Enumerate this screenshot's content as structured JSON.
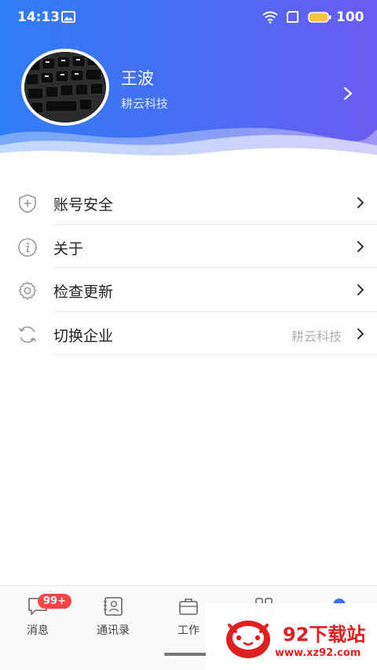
{
  "status_bar": {
    "time": "14:13",
    "battery": "100"
  },
  "profile": {
    "name": "王波",
    "company": "耕云科技"
  },
  "menu": [
    {
      "label": "账号安全",
      "value": "",
      "icon": "shield-icon"
    },
    {
      "label": "关于",
      "value": "",
      "icon": "info-icon"
    },
    {
      "label": "检查更新",
      "value": "",
      "icon": "gear-icon"
    },
    {
      "label": "切换企业",
      "value": "耕云科技",
      "icon": "refresh-icon"
    }
  ],
  "tabs": [
    {
      "label": "消息",
      "badge": "99+",
      "icon": "message-icon"
    },
    {
      "label": "通讯录",
      "icon": "contacts-icon"
    },
    {
      "label": "工作",
      "icon": "briefcase-icon"
    },
    {
      "label": "",
      "icon": "apps-icon"
    },
    {
      "label": "",
      "icon": "person-icon",
      "active": true
    }
  ],
  "watermark": {
    "title": "92下载站",
    "url": "www.xz92.com"
  },
  "colors": {
    "header_start": "#2f7df4",
    "header_end": "#6a5cf0",
    "badge": "#f04646",
    "active_tab": "#3d6ff2",
    "watermark": "#e02020"
  }
}
